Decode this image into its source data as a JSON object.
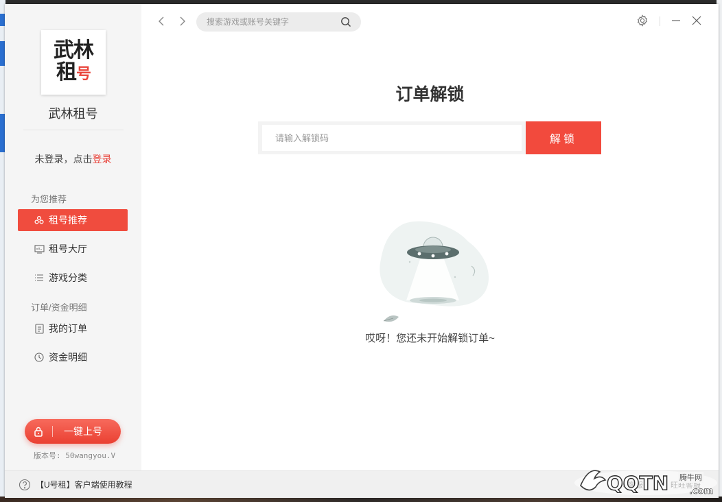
{
  "app": {
    "logo_line1": "武林",
    "logo_line2a": "租",
    "logo_line2b": "号",
    "name": "武林租号",
    "login_prefix": "未登录，点击",
    "login_link": "登录",
    "version": "版本号: 50wangyou.V"
  },
  "topbar": {
    "search_placeholder": "搜索游戏或账号关键字"
  },
  "sidebar": {
    "section1": "为您推荐",
    "section2": "订单/资金明细",
    "items": [
      {
        "label": "租号推荐",
        "icon": "rent-recommend-icon",
        "active": true
      },
      {
        "label": "租号大厅",
        "icon": "hall-icon",
        "active": false
      },
      {
        "label": "游戏分类",
        "icon": "list-icon",
        "active": false
      },
      {
        "label": "我的订单",
        "icon": "order-icon",
        "active": false
      },
      {
        "label": "资金明细",
        "icon": "clock-icon",
        "active": false
      }
    ],
    "quick_button": "一键上号"
  },
  "main": {
    "title": "订单解锁",
    "input_placeholder": "请输入解锁码",
    "unlock_button": "解锁",
    "empty_text": "哎呀！您还未开始解锁订单~"
  },
  "statusbar": {
    "tutorial": "【U号租】客户端使用教程",
    "right_a": "PC客服",
    "right_b": "旺旺客服"
  },
  "watermark": {
    "text": "QQTN",
    "suffix": ".com",
    "label": "腾牛网"
  },
  "colors": {
    "accent": "#f04c3e",
    "sidebar_bg": "#f5f5f5"
  }
}
